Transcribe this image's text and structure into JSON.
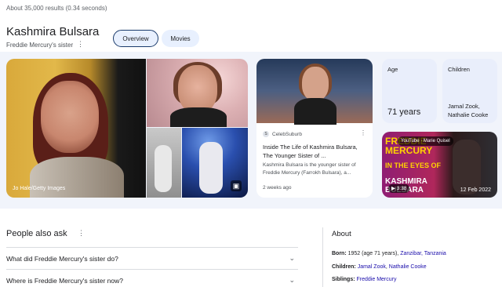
{
  "results_count": "About 35,000 results (0.34 seconds)",
  "entity": {
    "name": "Kashmira Bulsara",
    "subtitle": "Freddie Mercury's sister"
  },
  "chips": [
    {
      "label": "Overview",
      "selected": true
    },
    {
      "label": "Movies",
      "selected": false
    }
  ],
  "images": {
    "main_credit": "Jo Hale/Getty Images"
  },
  "article": {
    "source": "CelebSuburb",
    "headline": "Inside The Life of Kashmira Bulsara, The Younger Sister of ...",
    "snippet": "Kashmira Bulsara is the younger sister of Freddie Mercury (Farrokh Bulsara), a...",
    "date": "2 weeks ago"
  },
  "facts": {
    "age_label": "Age",
    "age_value": "71 years",
    "children_label": "Children",
    "children_value_1": "Jamal Zook,",
    "children_value_2": "Nathalie Cooke"
  },
  "video": {
    "source": "YouTube · Marie Quisel",
    "title_line1": "FREDDIE MERCURY",
    "title_line2": "IN THE EYES OF",
    "title_line3": "KASHMIRA BULSARA",
    "duration": "3:38",
    "date": "12 Feb 2022"
  },
  "people_also_ask": {
    "heading": "People also ask",
    "questions": [
      "What did Freddie Mercury's sister do?",
      "Where is Freddie Mercury's sister now?"
    ]
  },
  "about": {
    "heading": "About",
    "born_label": "Born:",
    "born_text": "1952 (age 71 years),",
    "born_link": "Zanzibar, Tanzania",
    "children_label": "Children:",
    "children_link1": "Jamal Zook",
    "children_sep": ",",
    "children_link2": "Nathalie Cooke",
    "siblings_label": "Siblings:",
    "siblings_link": "Freddie Mercury"
  },
  "colors": {
    "link": "#1a0dab",
    "chip_bg": "#e8f0fe",
    "fact_bg": "#e9eefb",
    "band_bg": "#f1f4fb"
  }
}
